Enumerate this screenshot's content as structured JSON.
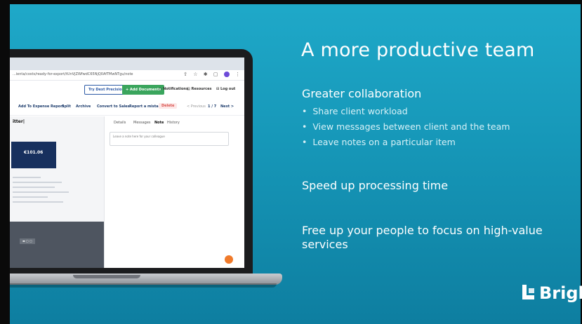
{
  "slide": {
    "headline": "A more productive team",
    "sections": [
      {
        "title": "Greater collaboration",
        "bullets": [
          "Share client workload",
          "View messages between client and the team",
          "Leave notes on a particular item"
        ]
      },
      {
        "title": "Speed up processing time"
      },
      {
        "title": "Free up your people to focus on high-value services"
      }
    ],
    "logo_text": "Bright"
  },
  "app": {
    "url": "...ienta/costs/ready-for-export/tUnVjZWfwdC65NjQ0AfTMwNTgu/note",
    "top_buttons": {
      "try_precision": "Try Dext Precision",
      "add_documents": "+ Add Documents",
      "notifications": "Notifications",
      "resources": "Resources",
      "logout": "Log out"
    },
    "actions": {
      "add_expense": "Add To Expense Report",
      "split": "Split",
      "archive": "Archive",
      "convert_sales": "Convert to Sales",
      "report_mistake": "Report a mistake",
      "delete": "Delete",
      "previous": "< Previous",
      "page": "1 / 7",
      "next": "Next >"
    },
    "doc": {
      "title": "itter|",
      "amount": "€101.06"
    },
    "note_tabs": {
      "details": "Details",
      "messages": "Messages",
      "note": "Note",
      "history": "History"
    },
    "note_placeholder": "Leave a note here for your colleague"
  },
  "colors": {
    "slide_bg": "#1697b8",
    "add_documents_green": "#3aa55d",
    "primary_blue": "#2d5aa6",
    "delete_red": "#d9534f",
    "chat_orange": "#f07a2a"
  }
}
